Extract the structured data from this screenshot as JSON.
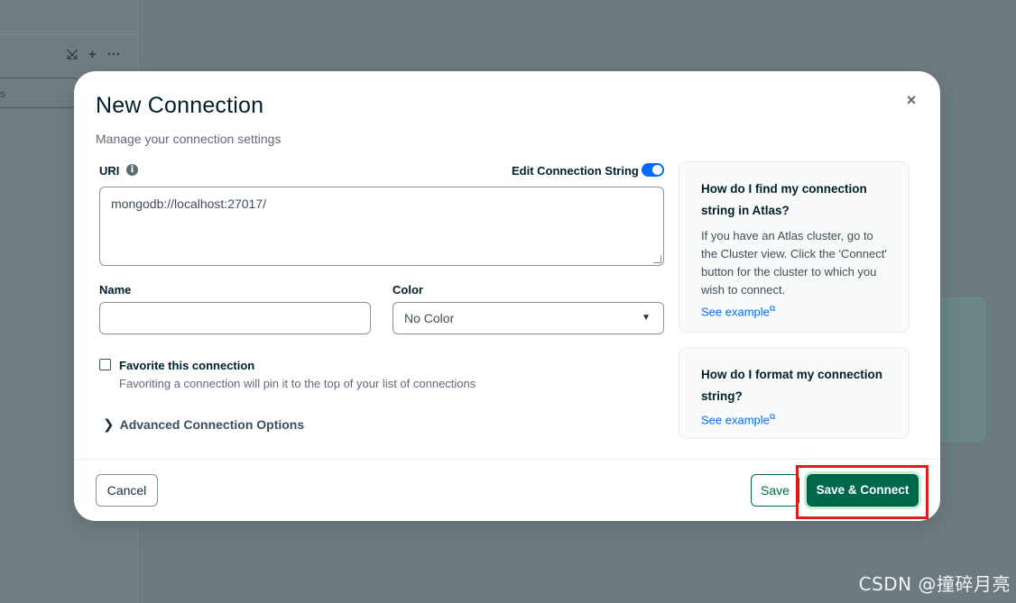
{
  "background": {
    "toolbar_icons": [
      "⤩",
      "+",
      "···"
    ],
    "search_text": "s"
  },
  "modal": {
    "title": "New Connection",
    "subtitle": "Manage your connection settings",
    "close": "×",
    "uri": {
      "label": "URI",
      "value": "mongodb://localhost:27017/",
      "edit_toggle_label": "Edit Connection String",
      "edit_toggle_on": true
    },
    "name": {
      "label": "Name",
      "value": ""
    },
    "color": {
      "label": "Color",
      "selected": "No Color"
    },
    "favorite": {
      "label": "Favorite this connection",
      "description": "Favoriting a connection will pin it to the top of your list of connections",
      "checked": false
    },
    "advanced_label": "Advanced Connection Options",
    "help": [
      {
        "title": "How do I find my connection string in Atlas?",
        "body": "If you have an Atlas cluster, go to the Cluster view. Click the 'Connect' button for the cluster to which you wish to connect.",
        "link": "See example"
      },
      {
        "title": "How do I format my connection string?",
        "body": "",
        "link": "See example"
      }
    ],
    "buttons": {
      "cancel": "Cancel",
      "save": "Save",
      "save_connect": "Save & Connect"
    }
  },
  "colors": {
    "primary_green": "#00684a",
    "link_blue": "#016bf8",
    "highlight_red": "#d71f1f"
  },
  "watermark": "CSDN @撞碎月亮"
}
